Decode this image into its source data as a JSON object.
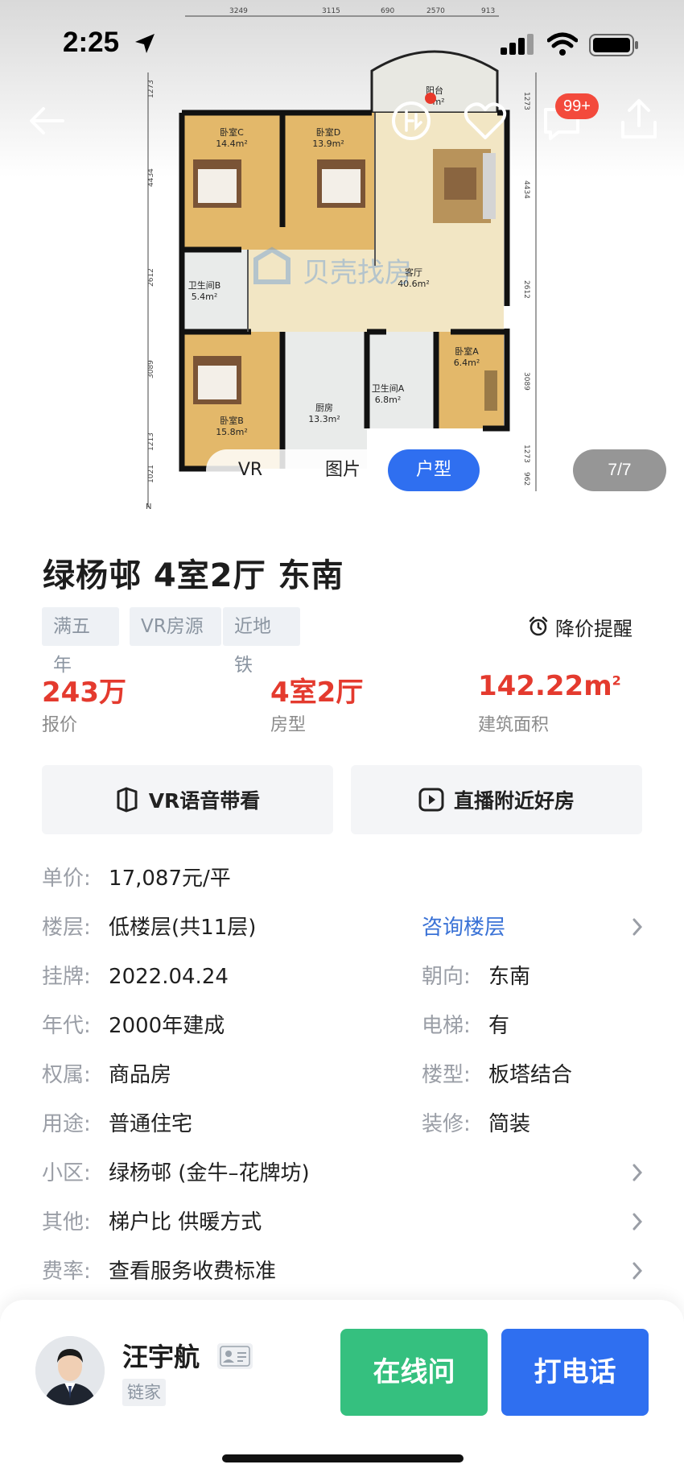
{
  "status_bar": {
    "time": "2:25"
  },
  "gallery": {
    "tabs": [
      "VR",
      "图片",
      "户型"
    ],
    "active_tab": "户型",
    "counter": "7/7",
    "message_badge": "99+",
    "floorplan": {
      "watermark": "贝壳找房",
      "rooms": [
        {
          "name": "阳台",
          "area": "m²"
        },
        {
          "name": "卧室C",
          "area": "14.4m²"
        },
        {
          "name": "卧室D",
          "area": "13.9m²"
        },
        {
          "name": "客厅",
          "area": "40.6m²"
        },
        {
          "name": "卫生间B",
          "area": "5.4m²"
        },
        {
          "name": "卧室B",
          "area": "15.8m²"
        },
        {
          "name": "厨房",
          "area": "13.3m²"
        },
        {
          "name": "卫生间A",
          "area": "6.8m²"
        },
        {
          "name": "卧室A",
          "area": "6.4m²"
        }
      ],
      "dims_top": [
        "3249",
        "3115",
        "690",
        "2570",
        "913"
      ],
      "dims_left": [
        "1273",
        "4434",
        "2612",
        "3089",
        "1213",
        "1021"
      ],
      "dims_right": [
        "1273",
        "4434",
        "2612",
        "3089",
        "1273",
        "962"
      ],
      "north": "N"
    }
  },
  "listing": {
    "title": "绿杨邨 4室2厅 东南",
    "tags": [
      "满五年",
      "VR房源",
      "近地铁"
    ],
    "price_alert": "降价提醒",
    "stats": [
      {
        "value": "243万",
        "label": "报价"
      },
      {
        "value": "4室2厅",
        "label": "房型"
      },
      {
        "value": "142.22m",
        "sup": "2",
        "label": "建筑面积"
      }
    ],
    "actions": [
      {
        "label": "VR语音带看",
        "icon": "vr-icon"
      },
      {
        "label": "直播附近好房",
        "icon": "live-play-icon"
      }
    ],
    "attributes": {
      "unit_price": {
        "key": "单价:",
        "value": "17,087元/平"
      },
      "floor": {
        "key": "楼层:",
        "value": "低楼层(共11层)",
        "link": "咨询楼层"
      },
      "listed": {
        "key": "挂牌:",
        "value": "2022.04.24"
      },
      "orientation": {
        "key": "朝向:",
        "value": "东南"
      },
      "year": {
        "key": "年代:",
        "value": "2000年建成"
      },
      "elevator": {
        "key": "电梯:",
        "value": "有"
      },
      "ownership": {
        "key": "权属:",
        "value": "商品房"
      },
      "building_type": {
        "key": "楼型:",
        "value": "板塔结合"
      },
      "usage": {
        "key": "用途:",
        "value": "普通住宅"
      },
      "decoration": {
        "key": "装修:",
        "value": "简装"
      },
      "community": {
        "key": "小区:",
        "value": "绿杨邨 (金牛–花牌坊)"
      },
      "other": {
        "key": "其他:",
        "value": "梯户比 供暖方式"
      },
      "fee": {
        "key": "费率:",
        "value": "查看服务收费标准"
      }
    }
  },
  "agent": {
    "name": "汪宇航",
    "company": "链家",
    "online_label": "在线问",
    "call_label": "打电话"
  },
  "colors": {
    "accent_blue": "#2f6ff0",
    "price_red": "#e43a2e",
    "online_green": "#35c07f",
    "link_blue": "#3a72d6",
    "badge_red": "#f34a3c"
  }
}
